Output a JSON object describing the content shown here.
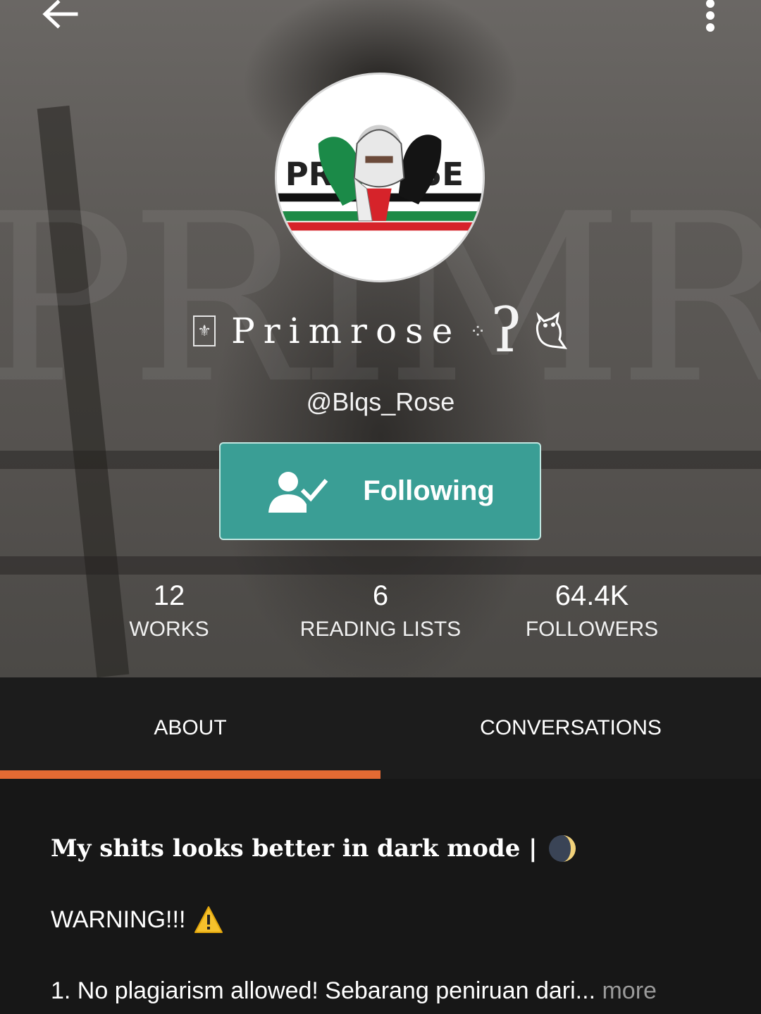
{
  "profile": {
    "display_name": "Primrose",
    "name_leading_glyph": "⚜",
    "name_sparkle": "⁘",
    "name_hook": "ʔ",
    "username": "@Blqs_Rose",
    "cover_word": "PRIMROSE",
    "follow_button_label": "Following",
    "avatar_text_left": "PR",
    "avatar_text_right": "SE"
  },
  "stats": [
    {
      "value": "12",
      "label": "WORKS"
    },
    {
      "value": "6",
      "label": "READING LISTS"
    },
    {
      "value": "64.4K",
      "label": "FOLLOWERS"
    }
  ],
  "tabs": [
    {
      "label": "ABOUT",
      "selected": true
    },
    {
      "label": "CONVERSATIONS",
      "selected": false
    }
  ],
  "about": {
    "line1": "My shits looks better in dark mode |",
    "line2": "WARNING!!!",
    "line3": "1. No plagiarism allowed! Sebarang peniruan dari",
    "ellipsis": "...",
    "more_label": "more"
  },
  "icons": {
    "back": "arrow-left-icon",
    "more": "more-vertical-icon",
    "follow": "user-check-icon",
    "owl": "owl-icon",
    "moon": "moon-icon",
    "warning": "warning-icon"
  },
  "colors": {
    "follow_button": "#3a9e95",
    "tab_indicator": "#e36a33",
    "background": "#171717",
    "tab_bar": "#1c1c1c",
    "more_link": "#9a9a9a"
  }
}
